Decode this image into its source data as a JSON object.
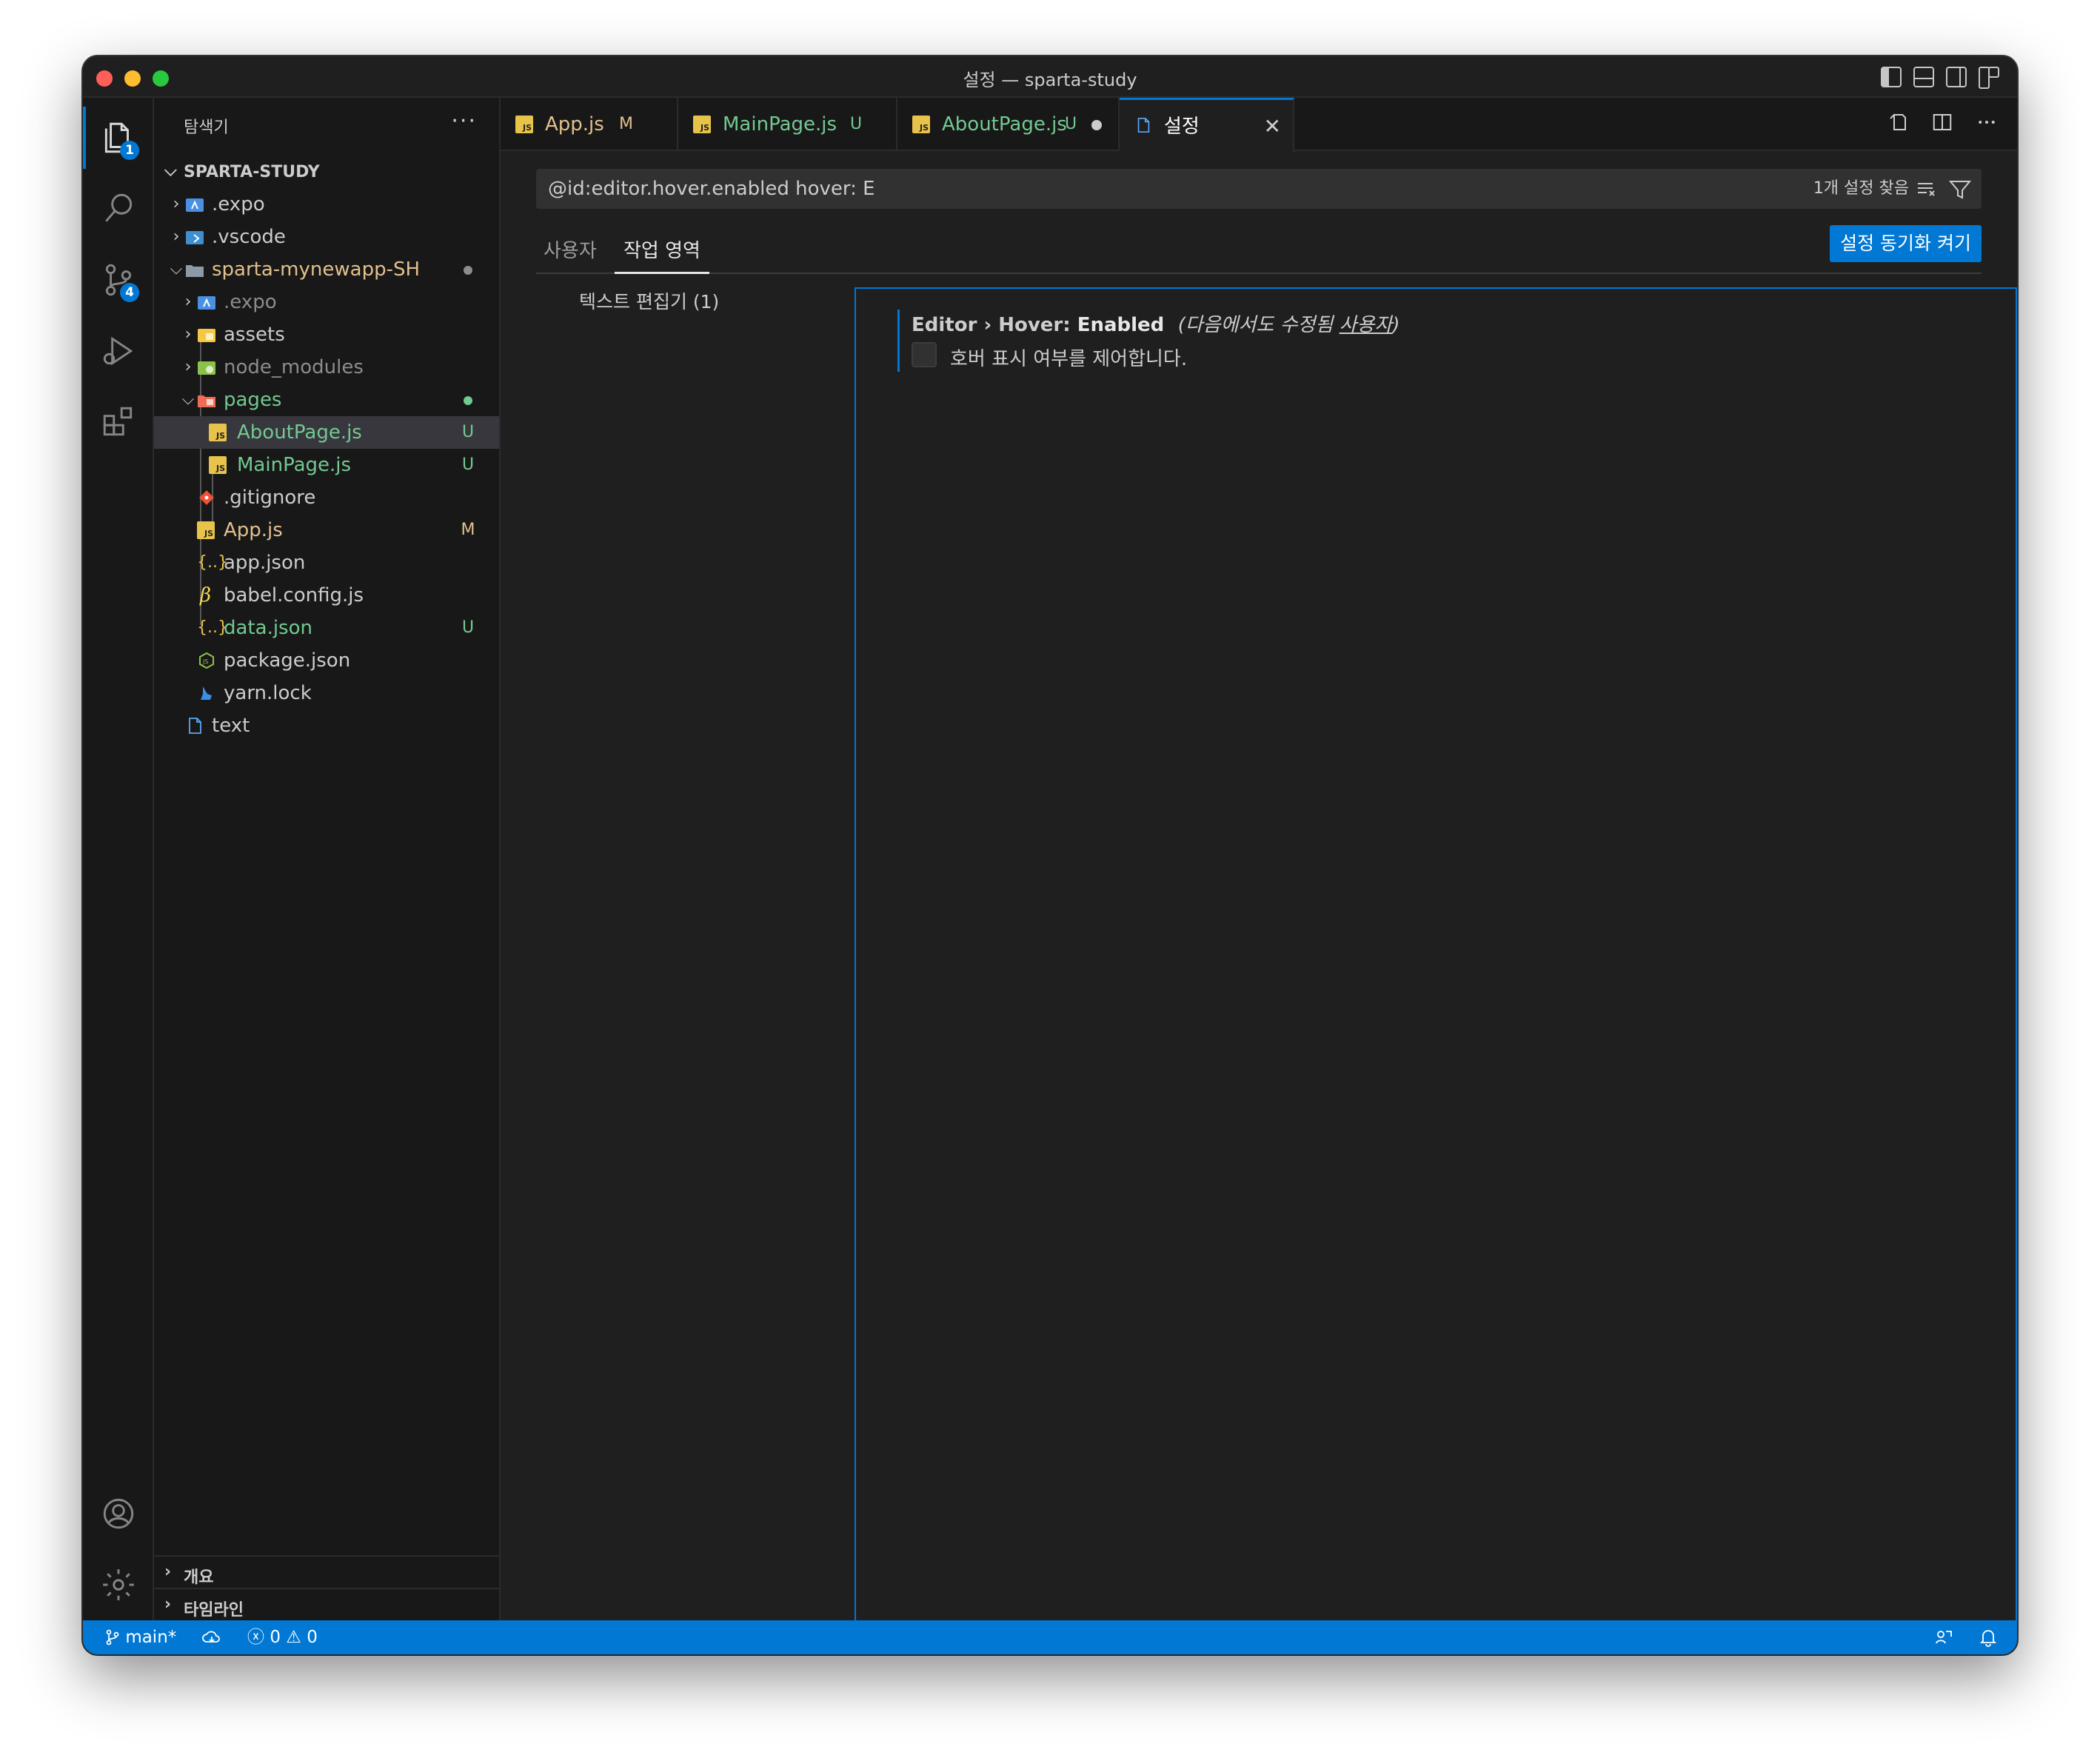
{
  "window": {
    "title": "설정 — sparta-study"
  },
  "activity_bar": {
    "explorer_badge": "1",
    "scm_badge": "4"
  },
  "sidebar": {
    "title": "탐색기",
    "more": "···",
    "root_label": "SPARTA-STUDY",
    "items": [
      {
        "name": ".expo",
        "status": ""
      },
      {
        "name": ".vscode",
        "status": ""
      },
      {
        "name": "sparta-mynewapp-SH",
        "status": ""
      },
      {
        "name": ".expo",
        "status": ""
      },
      {
        "name": "assets",
        "status": ""
      },
      {
        "name": "node_modules",
        "status": ""
      },
      {
        "name": "pages",
        "status": ""
      },
      {
        "name": "AboutPage.js",
        "status": "U"
      },
      {
        "name": "MainPage.js",
        "status": "U"
      },
      {
        "name": ".gitignore",
        "status": ""
      },
      {
        "name": "App.js",
        "status": "M"
      },
      {
        "name": "app.json",
        "status": ""
      },
      {
        "name": "babel.config.js",
        "status": ""
      },
      {
        "name": "data.json",
        "status": "U"
      },
      {
        "name": "package.json",
        "status": ""
      },
      {
        "name": "yarn.lock",
        "status": ""
      },
      {
        "name": "text",
        "status": ""
      }
    ],
    "outline_label": "개요",
    "timeline_label": "타임라인"
  },
  "tabs": [
    {
      "name": "App.js",
      "status": "M"
    },
    {
      "name": "MainPage.js",
      "status": "U"
    },
    {
      "name": "AboutPage.js",
      "status": "U"
    },
    {
      "name": "설정",
      "status": ""
    }
  ],
  "settings": {
    "search_value": "@id:editor.hover.enabled hover: E",
    "result_count": "1개 설정 찾음",
    "scope_user": "사용자",
    "scope_workspace": "작업 영역",
    "sync_button": "설정 동기화 켜기",
    "toc_item": "텍스트 편집기 (1)",
    "setting_category": "Editor › Hover: ",
    "setting_key": "Enabled",
    "modified_prefix": "(다음에서도 수정됨 ",
    "modified_link": "사용자",
    "modified_suffix": ")",
    "setting_description": "호버 표시 여부를 제어합니다."
  },
  "statusbar": {
    "branch": "main*",
    "errors": "0",
    "warnings": "0"
  },
  "colors": {
    "accent": "#0078d4",
    "untracked": "#73c991",
    "modified": "#e2c08d"
  }
}
